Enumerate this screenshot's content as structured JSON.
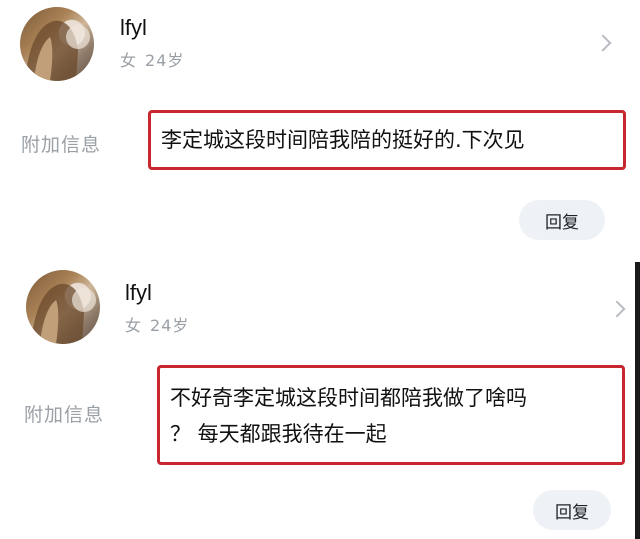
{
  "requests": [
    {
      "user": {
        "name": "lfyl",
        "gender": "女",
        "age": "24岁"
      },
      "label": "附加信息",
      "message_lines": [
        "李定城这段时间陪我陪的挺好的.下次见"
      ],
      "reply_label": "回复"
    },
    {
      "user": {
        "name": "lfyl",
        "gender": "女",
        "age": "24岁"
      },
      "label": "附加信息",
      "message_lines": [
        "不好奇李定城这段时间都陪我做了啥吗",
        "？ 每天都跟我待在一起"
      ],
      "reply_label": "回复"
    }
  ],
  "colors": {
    "highlight_border": "#c9272f",
    "muted_text": "#9aa0a6",
    "reply_bg": "#eef1f6"
  },
  "icons": [
    "avatar-photo",
    "chevron-right-icon"
  ]
}
